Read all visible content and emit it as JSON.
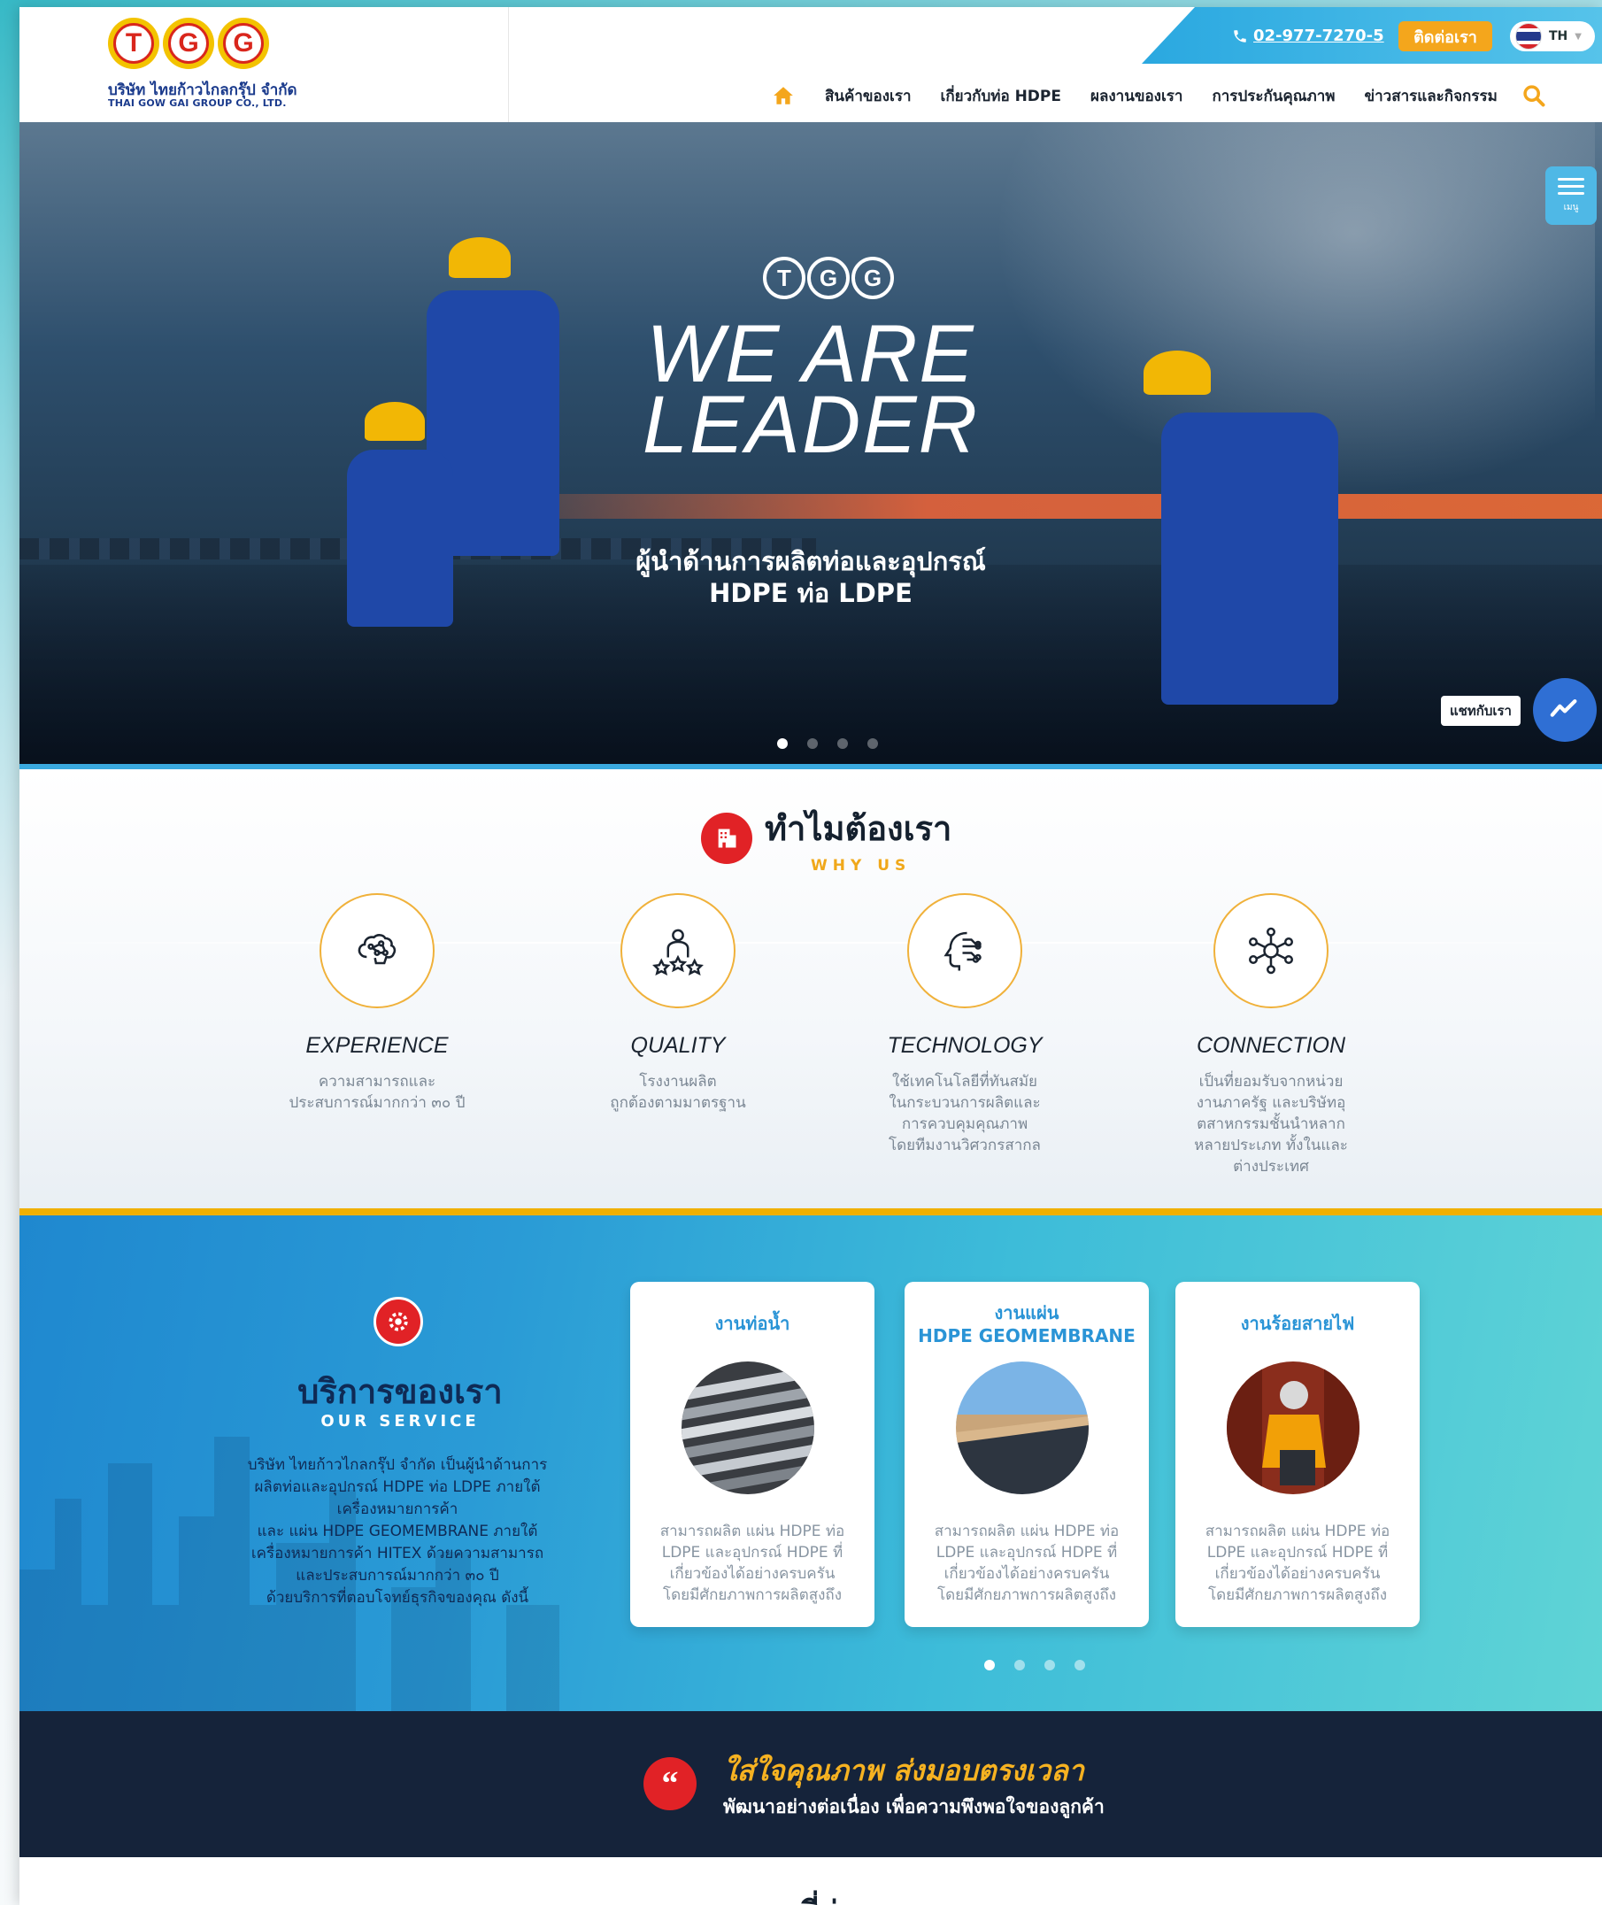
{
  "header": {
    "logo": {
      "letters": [
        "T",
        "G",
        "G"
      ],
      "name_th": "บริษัท ไทยก้าวไกลกรุ๊ป จำกัด",
      "name_en": "THAI GOW GAI GROUP CO., LTD."
    },
    "phone": "02-977-7270-5",
    "contact_button": "ติดต่อเรา",
    "language": "TH",
    "nav": [
      "สินค้าของเรา",
      "เกี่ยวกับท่อ HDPE",
      "ผลงานของเรา",
      "การประกันคุณภาพ",
      "ข่าวสารและกิจกรรม"
    ],
    "icons": {
      "home": "home-icon",
      "search": "search-icon",
      "phone": "phone-icon"
    }
  },
  "hero": {
    "brand": [
      "T",
      "G",
      "G"
    ],
    "title_line1": "WE ARE",
    "title_line2": "LEADER",
    "subtitle_line1": "ผู้นำด้านการผลิตท่อและอุปกรณ์",
    "subtitle_line2": "HDPE ท่อ LDPE",
    "slides": 4,
    "active_slide": 1,
    "menu_label": "เมนู",
    "chat_label": "แชทกับเรา"
  },
  "why_us": {
    "title": "ทำไมต้องเรา",
    "subtitle": "WHY US",
    "items": [
      {
        "name": "EXPERIENCE",
        "desc_lines": [
          "ความสามารถและ",
          "ประสบการณ์มากกว่า ๓๐ ปี"
        ],
        "icon": "brain-network-icon"
      },
      {
        "name": "QUALITY",
        "desc_lines": [
          "โรงงานผลิต",
          "ถูกต้องตามมาตรฐาน"
        ],
        "icon": "person-stars-icon"
      },
      {
        "name": "TECHNOLOGY",
        "desc_lines": [
          "ใช้เทคโนโลยีที่ทันสมัย",
          "ในกระบวนการผลิตและ",
          "การควบคุมคุณภาพ",
          "โดยทีมงานวิศวกรสากล"
        ],
        "icon": "circuit-head-icon"
      },
      {
        "name": "CONNECTION",
        "desc_lines": [
          "เป็นที่ยอมรับจากหน่วย",
          "งานภาครัฐ และบริษัทอุ",
          "ตสาหกรรมชั้นนำหลาก",
          "หลายประเภท ทั้งในและ",
          "ต่างประเทศ"
        ],
        "icon": "network-people-icon"
      }
    ]
  },
  "services": {
    "title": "บริการของเรา",
    "subtitle": "OUR SERVICE",
    "desc_lines": [
      "บริษัท ไทยก้าวไกลกรุ๊ป จำกัด เป็นผู้นำด้านการ",
      "ผลิตท่อและอุปกรณ์ HDPE ท่อ LDPE ภายใต้",
      "เครื่องหมายการค้า",
      "และ แผ่น HDPE GEOMEMBRANE ภายใต้",
      "เครื่องหมายการค้า HITEX ด้วยความสามารถ",
      "และประสบการณ์มากกว่า ๓๐ ปี",
      "ด้วยบริการที่ตอบโจทย์ธุรกิจของคุณ ดังนี้"
    ],
    "cards": [
      {
        "title_lines": [
          "งานท่อน้ำ"
        ],
        "text_lines": [
          "สามารถผลิต แผ่น HDPE ท่อ",
          "LDPE และอุปกรณ์ HDPE ที่",
          "เกี่ยวข้องได้อย่างครบครัน",
          "โดยมีศักยภาพการผลิตสูงถึง"
        ]
      },
      {
        "title_lines": [
          "งานแผ่น",
          "HDPE GEOMEMBRANE"
        ],
        "text_lines": [
          "สามารถผลิต แผ่น HDPE ท่อ",
          "LDPE และอุปกรณ์ HDPE ที่",
          "เกี่ยวข้องได้อย่างครบครัน",
          "โดยมีศักยภาพการผลิตสูงถึง"
        ]
      },
      {
        "title_lines": [
          "งานร้อยสายไฟ"
        ],
        "text_lines": [
          "สามารถผลิต แผ่น HDPE ท่อ",
          "LDPE และอุปกรณ์ HDPE ที่",
          "เกี่ยวข้องได้อย่างครบครัน",
          "โดยมีศักยภาพการผลิตสูงถึง"
        ]
      }
    ],
    "slides": 4,
    "active_slide": 1
  },
  "quote": {
    "title": "ใส่ใจคุณภาพ ส่งมอบตรงเวลา",
    "subtitle": "พัฒนาอย่างต่อเนื่อง เพื่อความพึงพอใจของลูกค้า"
  },
  "next_section": {
    "title": "ผลงานที่ผ่านมา"
  },
  "colors": {
    "accent_red": "#e12226",
    "accent_orange": "#f4a61c",
    "brand_blue": "#2a94d6",
    "dark_navy": "#15233a"
  }
}
